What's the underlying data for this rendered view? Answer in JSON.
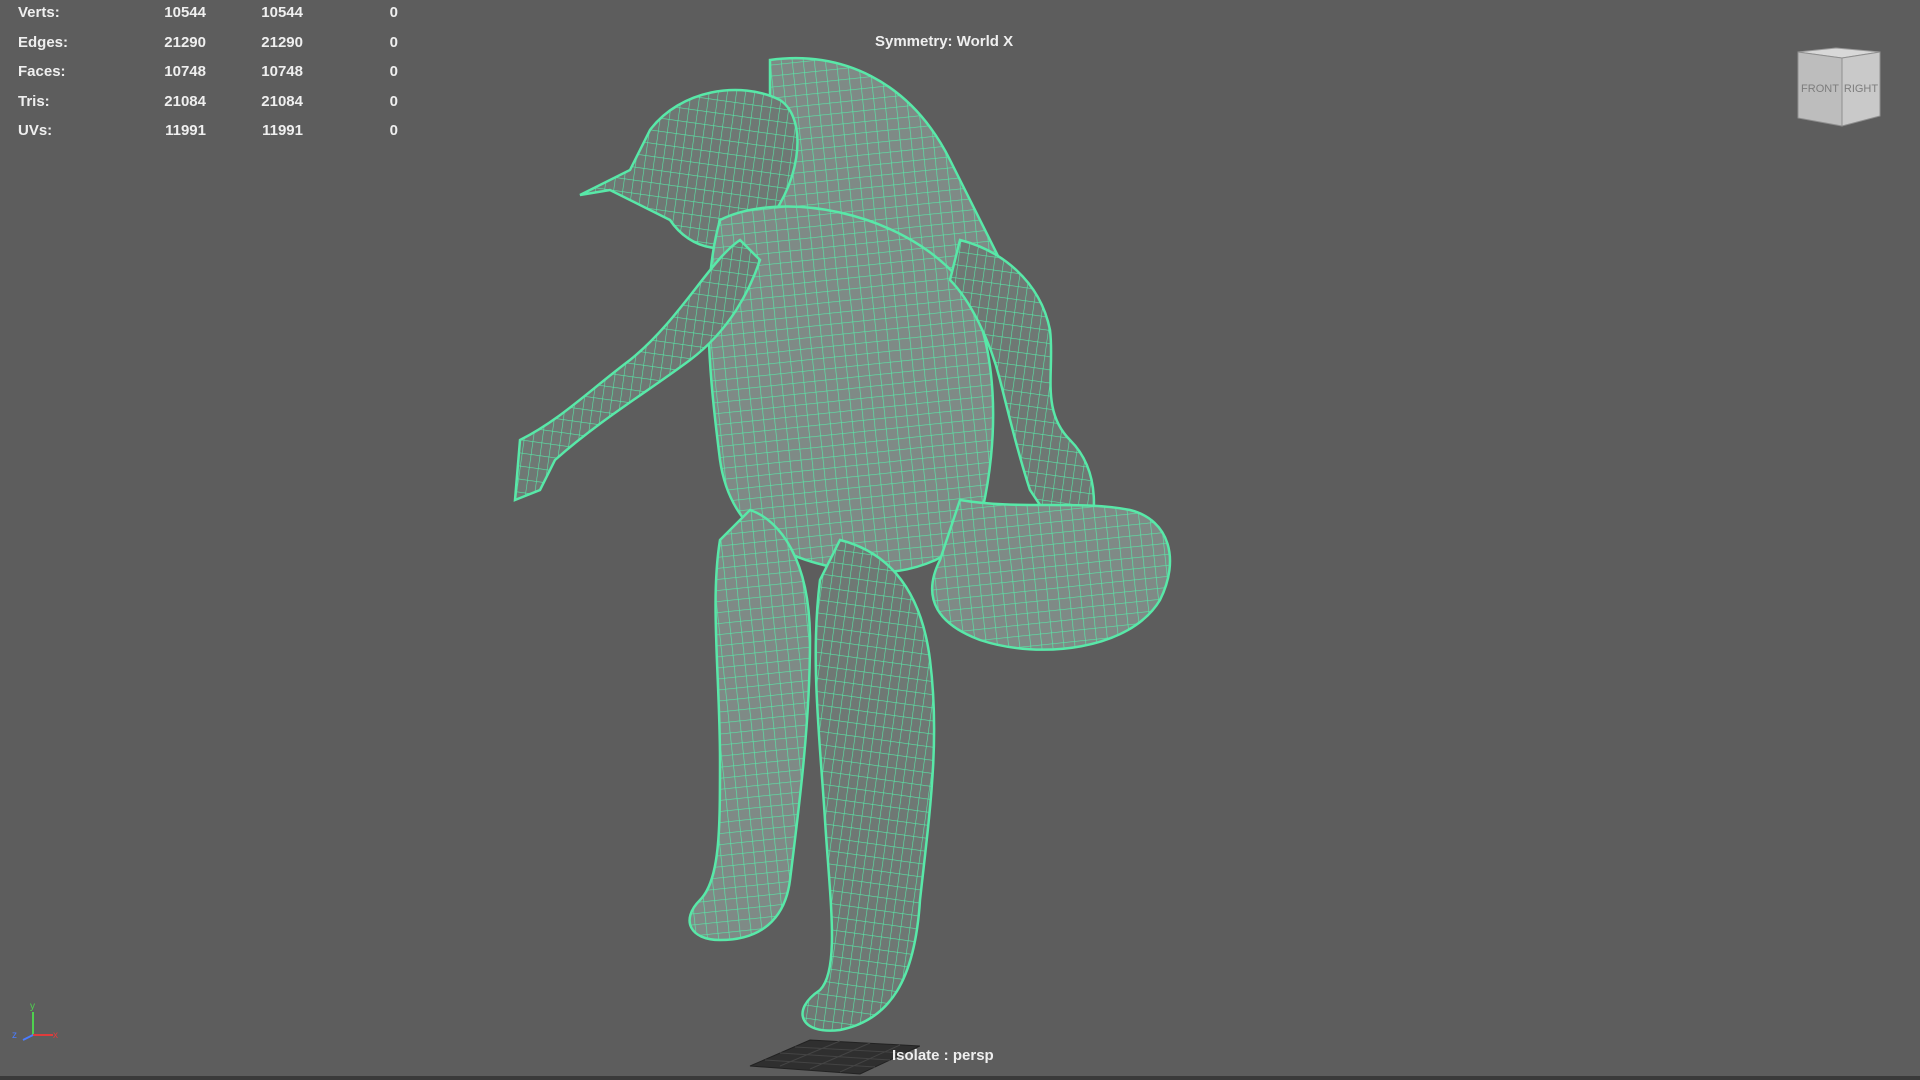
{
  "hud": {
    "stats": [
      {
        "label": "Verts:",
        "v1": "10544",
        "v2": "10544",
        "v3": "0"
      },
      {
        "label": "Edges:",
        "v1": "21290",
        "v2": "21290",
        "v3": "0"
      },
      {
        "label": "Faces:",
        "v1": "10748",
        "v2": "10748",
        "v3": "0"
      },
      {
        "label": "Tris:",
        "v1": "21084",
        "v2": "21084",
        "v3": "0"
      },
      {
        "label": "UVs:",
        "v1": "11991",
        "v2": "11991",
        "v3": "0"
      }
    ],
    "symmetry": "Symmetry: World X",
    "isolate": "Isolate : persp"
  },
  "viewcube": {
    "front": "FRONT",
    "right": "RIGHT"
  },
  "axis": {
    "x": "x",
    "y": "y",
    "z": "z",
    "x_color": "#e03c3c",
    "y_color": "#4fd14f",
    "z_color": "#4a7cff"
  },
  "colors": {
    "background": "#5d5d5d",
    "wireframe": "#58e8a8",
    "mesh_fill": "#7f8a86"
  },
  "model": {
    "name": "creature-mesh-icon"
  }
}
